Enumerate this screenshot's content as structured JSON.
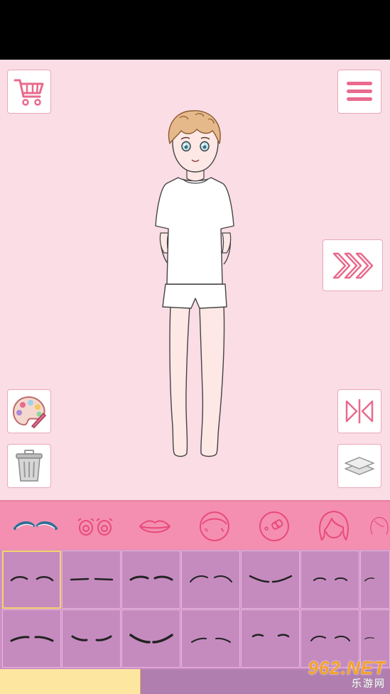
{
  "colors": {
    "stage_bg": "#fbdde6",
    "tab_bar": "#f48fb1",
    "grid_bg": "#cf8fc4",
    "selected_border": "#f7d36b",
    "progress_fill": "#fde7a0",
    "icon_pink": "#e96a8c"
  },
  "toolbar": {
    "shop_icon": "shopping-cart-icon",
    "menu_icon": "hamburger-menu-icon",
    "next_icon": "triple-chevron-right-icon",
    "palette_icon": "paint-palette-icon",
    "flip_icon": "mirror-flip-icon",
    "trash_icon": "trash-can-icon",
    "layers_icon": "layers-icon"
  },
  "category_tabs": [
    {
      "name": "eyebrows",
      "icon": "eyebrow-icon",
      "selected": true
    },
    {
      "name": "eyes",
      "icon": "eyes-icon"
    },
    {
      "name": "mouth",
      "icon": "lips-icon"
    },
    {
      "name": "face",
      "icon": "face-blush-icon"
    },
    {
      "name": "face-accessory",
      "icon": "face-bandage-icon"
    },
    {
      "name": "hair",
      "icon": "hair-icon"
    },
    {
      "name": "hair-back",
      "icon": "hair-partial-icon"
    }
  ],
  "eyebrow_options": [
    {
      "style": "arched-thin",
      "selected": true
    },
    {
      "style": "straight"
    },
    {
      "style": "soft-arch"
    },
    {
      "style": "high-arch"
    },
    {
      "style": "angled-down"
    },
    {
      "style": "small-arch"
    },
    {
      "style": "partial"
    },
    {
      "style": "tilted"
    },
    {
      "style": "droopy"
    },
    {
      "style": "sad-thick"
    },
    {
      "style": "curved-low"
    },
    {
      "style": "raised"
    },
    {
      "style": "round-arch"
    },
    {
      "style": "partial-2"
    }
  ],
  "progress": 0.36,
  "watermark": {
    "line1": "962.NET",
    "line2": "乐游网"
  }
}
